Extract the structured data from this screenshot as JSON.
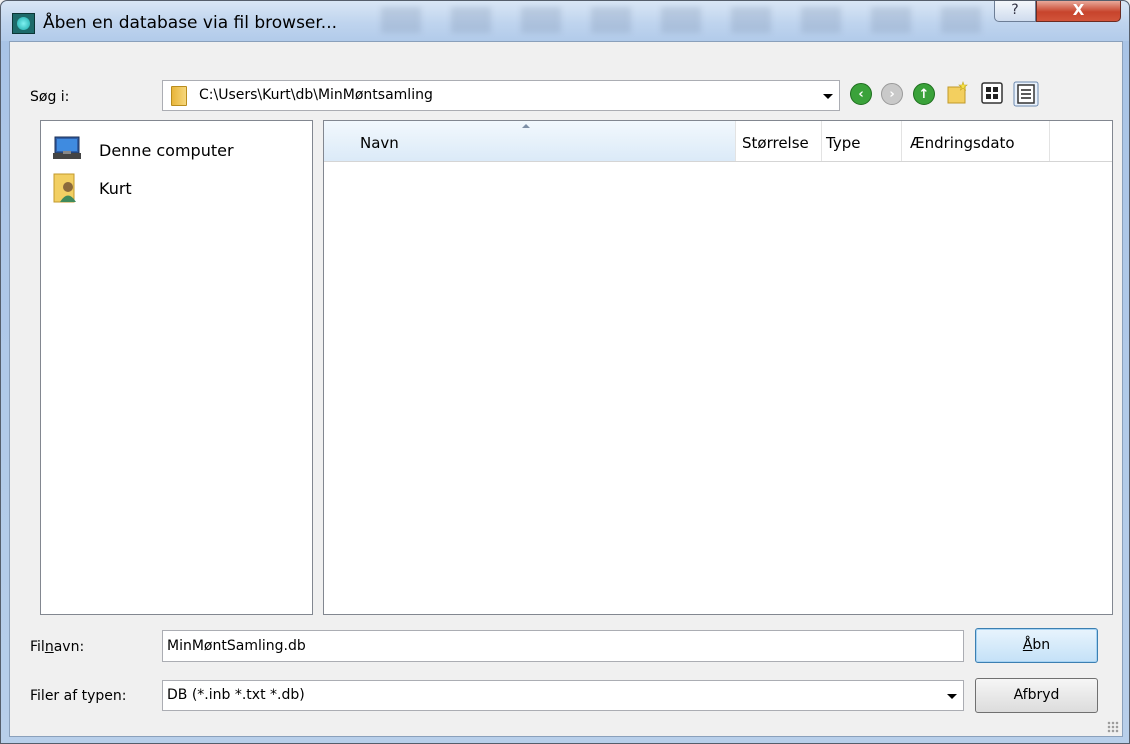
{
  "window": {
    "title": "Åben en database via fil browser...",
    "help_label": "?",
    "close_label": "X"
  },
  "lookin": {
    "label": "Søg i:",
    "path": "C:\\Users\\Kurt\\db\\MinMøntsamling"
  },
  "toolbar": {
    "back_icon": "back-arrow-icon",
    "forward_icon": "forward-arrow-icon",
    "up_icon": "up-arrow-icon",
    "new_folder_icon": "new-folder-icon",
    "list_view_icon": "list-view-icon",
    "details_view_icon": "details-view-icon"
  },
  "places": [
    {
      "label": "Denne computer",
      "icon": "computer-icon"
    },
    {
      "label": "Kurt",
      "icon": "user-folder-icon"
    }
  ],
  "filelist": {
    "columns": [
      "Navn",
      "Størrelse",
      "Type",
      "Ændringsdato"
    ],
    "rows": []
  },
  "filename": {
    "label_pre": "Fil",
    "label_accel": "n",
    "label_post": "avn:",
    "value": "MinMøntSamling.db"
  },
  "filetype": {
    "label": "Filer af typen:",
    "value": "DB (*.inb *.txt *.db)"
  },
  "buttons": {
    "open_accel": "Å",
    "open_rest": "bn",
    "cancel": "Afbryd"
  },
  "colors": {
    "accent": "#3c7fb1",
    "close": "#c7442c",
    "titlebar": "#bfd4ee"
  }
}
